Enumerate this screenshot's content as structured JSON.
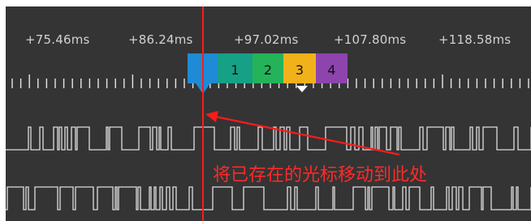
{
  "timeline": {
    "labels": [
      "+75.46ms",
      "+86.24ms",
      "+97.02ms",
      "+107.80ms",
      "+118.58ms"
    ],
    "label_color": "#d2d2d2"
  },
  "markers": [
    {
      "label": "",
      "color": "#1f8ad6",
      "icon": "active-cursor-flag"
    },
    {
      "label": "1",
      "color": "#16a085",
      "icon": "marker-flag"
    },
    {
      "label": "2",
      "color": "#24b35a",
      "icon": "marker-flag"
    },
    {
      "label": "3",
      "color": "#f1b11a",
      "icon": "marker-flag"
    },
    {
      "label": "4",
      "color": "#8e44ad",
      "icon": "marker-flag"
    }
  ],
  "cursor": {
    "color": "#ff1a1a"
  },
  "annotation": {
    "text": "将已存在的光标移动到此处",
    "color": "#ff2a2a",
    "icon": "left-arrow"
  },
  "signals": {
    "color": "#dedede",
    "channel_count": 2
  },
  "colors": {
    "background": "#343434",
    "tick": "#e6e6e6"
  }
}
